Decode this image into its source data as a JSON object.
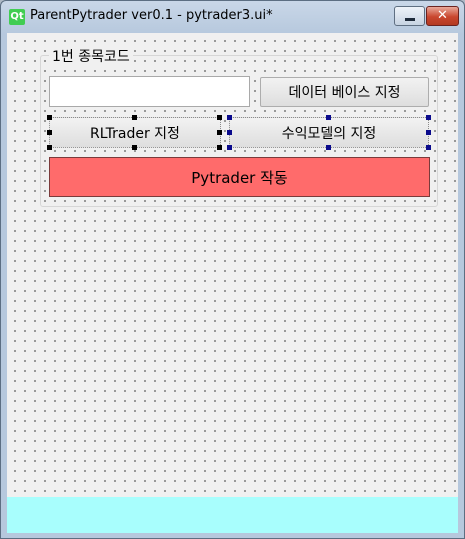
{
  "window": {
    "title": "ParentPytrader ver0.1 - pytrader3.ui*",
    "app_icon": "Qt",
    "close_glyph": "✕"
  },
  "form": {
    "group_title": "1번 종목코드",
    "code_input_value": "",
    "code_input_placeholder": "",
    "db_button_label": "데이터 베이스 지정",
    "rl_button_label": "RLTrader 지정",
    "profit_button_label": "수익모델의 지정",
    "run_button_label": "Pytrader 작동"
  },
  "colors": {
    "run_button": "#ff6b6b",
    "status_bar": "#a8fefd",
    "canvas": "#f0f0f0",
    "qt_green": "#41cd52"
  },
  "icons": [
    "qt-logo-icon",
    "minimize-icon",
    "close-icon"
  ]
}
